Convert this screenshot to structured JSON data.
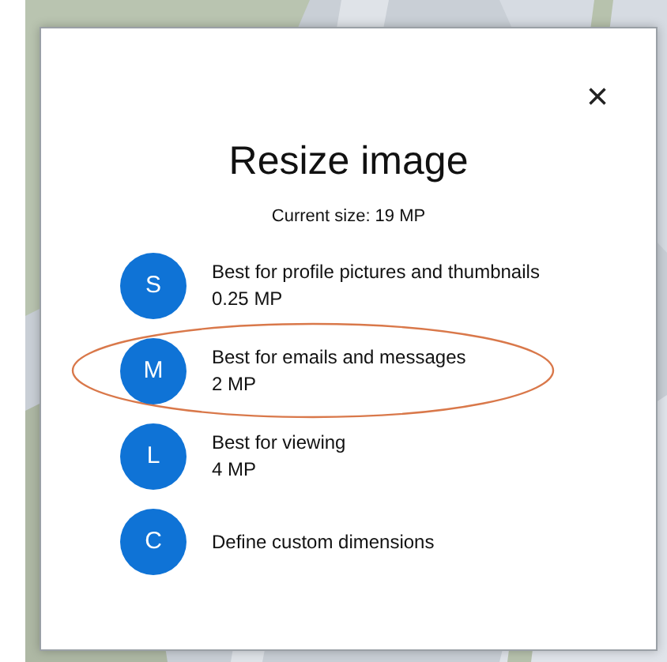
{
  "dialog": {
    "title": "Resize image",
    "subtitle": "Current size: 19 MP",
    "close": "×"
  },
  "options": [
    {
      "letter": "S",
      "label": "Best for profile pictures and thumbnails",
      "size": "0.25 MP",
      "highlighted": false
    },
    {
      "letter": "M",
      "label": "Best for emails and messages",
      "size": "2 MP",
      "highlighted": true
    },
    {
      "letter": "L",
      "label": "Best for viewing",
      "size": "4 MP",
      "highlighted": false
    },
    {
      "letter": "C",
      "label": "Define custom dimensions",
      "highlighted": false
    }
  ]
}
